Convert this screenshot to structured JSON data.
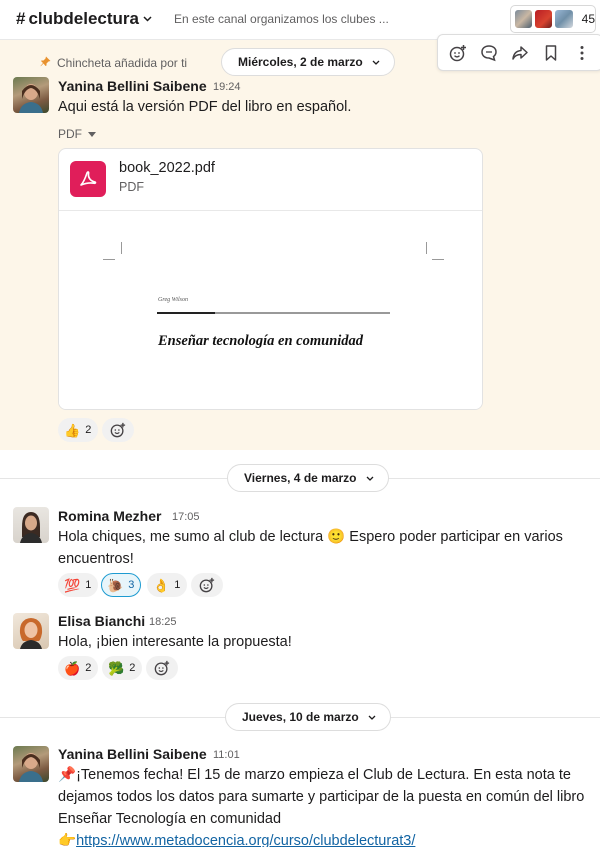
{
  "header": {
    "hash": "#",
    "channel_name": "clubdelectura",
    "topic": "En este canal organizamos los clubes ...",
    "member_count": "45"
  },
  "pinned_note": "Chincheta añadida por ti",
  "dates": {
    "d1": "Miércoles, 2 de marzo",
    "d2": "Viernes, 4 de marzo",
    "d3": "Jueves, 10 de marzo"
  },
  "messages": [
    {
      "author": "Yanina Bellini Saibene",
      "time": "19:24",
      "text": "Aqui está la versión PDF del libro en español.",
      "attachment_label": "PDF",
      "file": {
        "name": "book_2022.pdf",
        "type": "PDF",
        "preview_author": "Greg Wilson",
        "preview_title": "Enseñar tecnología en comunidad"
      },
      "reactions": [
        {
          "emoji": "👍",
          "count": "2"
        }
      ]
    },
    {
      "author": "Romina Mezher",
      "time": "17:05",
      "text_before": "Hola chiques, me sumo al club de lectura ",
      "emoji_inline": "🙂",
      "text_after": " Espero poder participar en varios encuentros!",
      "reactions": [
        {
          "emoji": "💯",
          "count": "1"
        },
        {
          "emoji": "🐌",
          "count": "3"
        },
        {
          "emoji": "👌",
          "count": "1"
        }
      ]
    },
    {
      "author": "Elisa Bianchi",
      "time": "18:25",
      "text": "Hola, ¡bien interesante la propuesta!",
      "reactions": [
        {
          "emoji": "🍎",
          "count": "2"
        },
        {
          "emoji": "🥦",
          "count": "2"
        }
      ]
    },
    {
      "author": "Yanina Bellini Saibene",
      "time": "11:01",
      "emoji_start": "📌",
      "text": "¡Tenemos fecha! El 15 de marzo empieza el Club de Lectura. En esta nota te dejamos todos los datos para sumarte y participar de la puesta en común del libro Enseñar Tecnología en comunidad",
      "link_emoji": "👉",
      "link": "https://www.metadocencia.org/curso/clubdelecturat3/"
    }
  ],
  "colors": {
    "pinned_bg": "#fdf6e9",
    "pdf_red": "#e01e5a",
    "link_blue": "#1264a3",
    "active_reaction_border": "#1d9bd1"
  },
  "icons": [
    "add-reaction-icon",
    "reply-thread-icon",
    "share-icon",
    "bookmark-icon",
    "more-icon",
    "pin-icon",
    "pdf-icon",
    "chevron-down-icon"
  ]
}
